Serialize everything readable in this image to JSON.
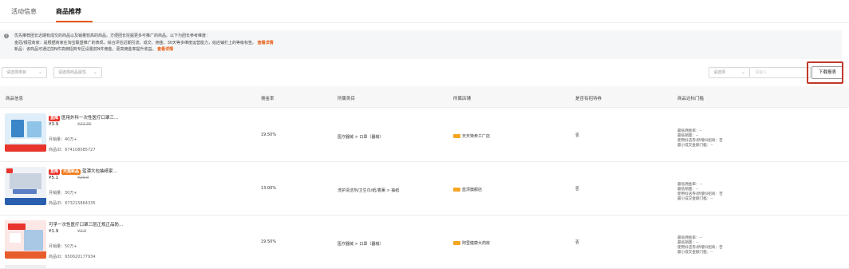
{
  "tabs": [
    {
      "label": "活动信息"
    },
    {
      "label": "商品推荐"
    }
  ],
  "notice": {
    "line1": "优先推荐团长近期有成交的商品以及销量较高的商品。方便团长挖掘更多可推广的商品。以下为团长参考维度：",
    "line2": "金冠/银冠商家：是根据商家在淘宝联盟推广的表现，综合评估近期引流、成交、佣金、30天等多维度运营能力，给店铺打上的等级标签。",
    "line2_link": "查看详情",
    "line3": "新品：该商品可通过前N件高佣招商专区设置前N件佣金，更高佣金率提升收益。",
    "line3_link": "查看详情"
  },
  "filters": {
    "category": "请选择类目",
    "attribute": "请选择商品属性",
    "search_type": "请选择",
    "search_placeholder": "请输入",
    "download_label": "下载报表"
  },
  "columns": [
    "商品信息",
    "佣金率",
    "所属类目",
    "所属店铺",
    "是否有招待券",
    "商品达标门槛"
  ],
  "threshold_lines": [
    "最低佣金率：--",
    "最低销量：--",
    "使用抖店券/新增抖招商：否",
    "最小成交金额门槛：--"
  ],
  "colors": {
    "accent": "#e8590c",
    "highlight_border": "#c0392b",
    "tag_red": "#e8342c",
    "tag_orange": "#f07a1a"
  },
  "rows": [
    {
      "tags": [
        {
          "text": "直降",
          "color": "#e8342c"
        }
      ],
      "title": "医用外科一次性医疗口罩三...",
      "price": "¥3.9",
      "orig_price": "¥22.35",
      "sales": "月销量：40万+",
      "product_id": "商品ID：674108085727",
      "commission": "19.50%",
      "category": "医疗器械 > 口罩（器械）",
      "shop": "天天特卖工厂店",
      "has_coupon": "否"
    },
    {
      "tags": [
        {
          "text": "直降",
          "color": "#e8342c"
        },
        {
          "text": "天猫新品",
          "color": "#f07a1a"
        }
      ],
      "title": "蓝漂大包抽纸家...",
      "price": "¥5.1",
      "orig_price": "¥29.9",
      "sales": "月销量：30万+",
      "product_id": "商品ID：673215864335",
      "commission": "13.00%",
      "category": "洗护清洁剂/卫生巾/纸/香薰 > 抽纸",
      "shop": "蓝漂旗舰店",
      "has_coupon": "否"
    },
    {
      "tags": [],
      "title": "可孚一次性医疗口罩三层正规正品防...",
      "price": "¥1.9",
      "orig_price": "¥2.9",
      "sales": "月销量：50万+",
      "product_id": "商品ID：650620177934",
      "commission": "19.50%",
      "category": "医疗器械 > 口罩（器械）",
      "shop": "阿里健康大药房",
      "has_coupon": "否"
    }
  ]
}
